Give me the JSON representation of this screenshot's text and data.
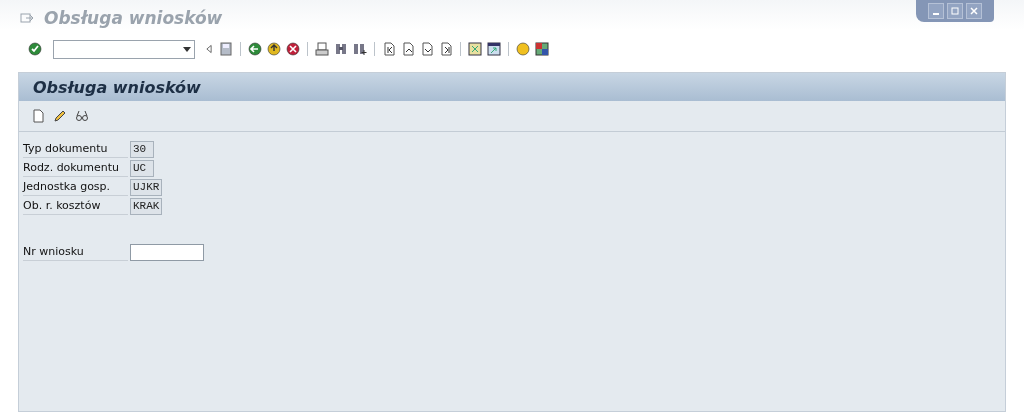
{
  "window": {
    "title": "Obsługa wniosków"
  },
  "screen": {
    "title": "Obsługa wniosków"
  },
  "fields": [
    {
      "label": "Typ dokumentu",
      "value": "30",
      "kind": "display"
    },
    {
      "label": "Rodz. dokumentu",
      "value": "UC",
      "kind": "display"
    },
    {
      "label": "Jednostka gosp.",
      "value": "UJKR",
      "kind": "display"
    },
    {
      "label": "Ob. r. kosztów",
      "value": "KRAK",
      "kind": "display"
    },
    {
      "label": "Nr wniosku",
      "kind": "input"
    }
  ]
}
